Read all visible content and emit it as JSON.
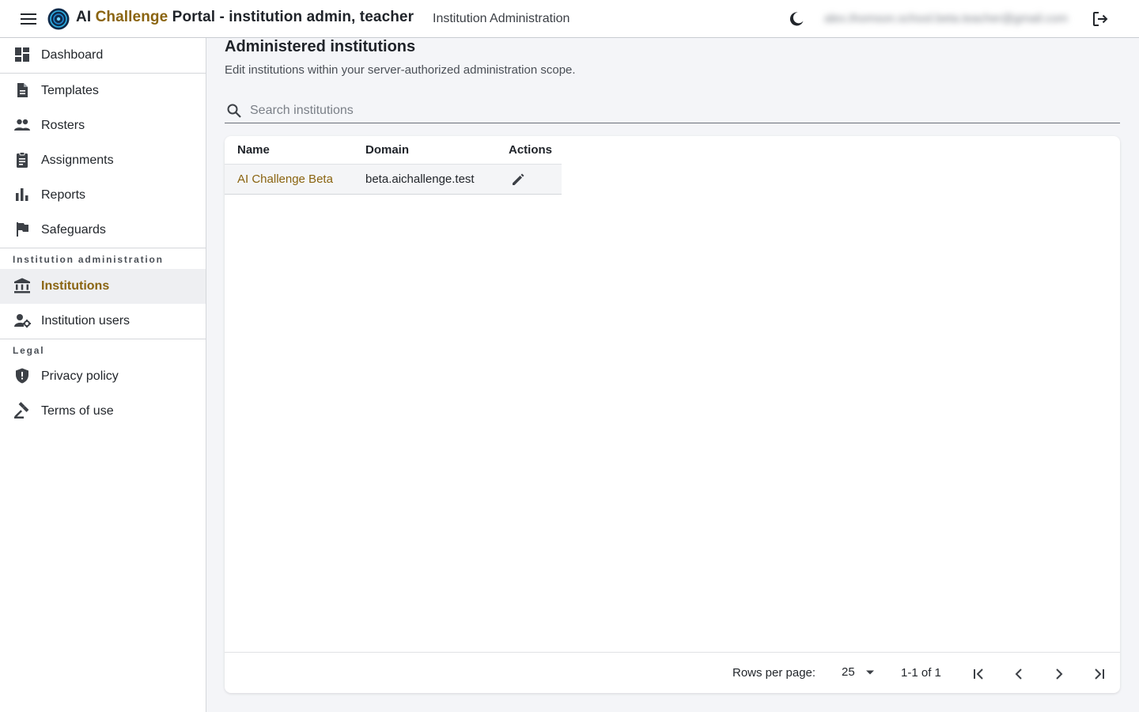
{
  "header": {
    "title_prefix": "AI ",
    "title_accent": "Challenge",
    "title_suffix": " Portal - institution admin, teacher",
    "context": "Institution Administration",
    "user_email": "alex.thomson.school.beta.teacher@gmail.com",
    "icons": {
      "menu": "menu-icon",
      "logo": "logo-icon",
      "theme": "moon-icon",
      "logout": "logout-icon"
    }
  },
  "sidebar": {
    "items": [
      {
        "label": "Dashboard",
        "icon": "dashboard-icon"
      },
      {
        "label": "Templates",
        "icon": "document-icon"
      },
      {
        "label": "Rosters",
        "icon": "people-icon"
      },
      {
        "label": "Assignments",
        "icon": "clipboard-icon"
      },
      {
        "label": "Reports",
        "icon": "bar-chart-icon"
      },
      {
        "label": "Safeguards",
        "icon": "flag-icon"
      }
    ],
    "institution_section": "Institution administration",
    "institution_items": [
      {
        "label": "Institutions",
        "icon": "bank-icon",
        "active": true
      },
      {
        "label": "Institution users",
        "icon": "user-settings-icon"
      }
    ],
    "legal_section": "Legal",
    "legal_items": [
      {
        "label": "Privacy policy",
        "icon": "shield-icon"
      },
      {
        "label": "Terms of use",
        "icon": "gavel-icon"
      }
    ]
  },
  "main": {
    "title": "Administered institutions",
    "subtitle": "Edit institutions within your server-authorized administration scope.",
    "search": {
      "placeholder": "Search institutions",
      "value": ""
    },
    "table": {
      "columns": [
        "Name",
        "Domain",
        "Actions"
      ],
      "rows": [
        {
          "name": "AI Challenge Beta",
          "domain": "beta.aichallenge.test",
          "action_icon": "pencil-icon"
        }
      ]
    },
    "pagination": {
      "rows_per_page_label": "Rows per page:",
      "rows_per_page": "25",
      "range": "1-1 of 1"
    }
  },
  "colors": {
    "accent": "#8a6410",
    "active_bg": "#eeeff2",
    "page_bg": "#f4f5f8"
  }
}
